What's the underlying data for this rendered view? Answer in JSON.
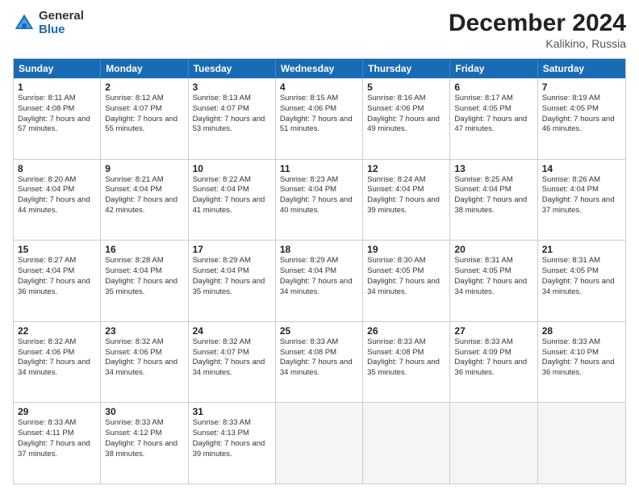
{
  "header": {
    "logo_general": "General",
    "logo_blue": "Blue",
    "month_title": "December 2024",
    "location": "Kalikino, Russia"
  },
  "days_of_week": [
    "Sunday",
    "Monday",
    "Tuesday",
    "Wednesday",
    "Thursday",
    "Friday",
    "Saturday"
  ],
  "weeks": [
    [
      {
        "day": "1",
        "sunrise": "8:11 AM",
        "sunset": "4:08 PM",
        "daylight": "7 hours and 57 minutes."
      },
      {
        "day": "2",
        "sunrise": "8:12 AM",
        "sunset": "4:07 PM",
        "daylight": "7 hours and 55 minutes."
      },
      {
        "day": "3",
        "sunrise": "8:13 AM",
        "sunset": "4:07 PM",
        "daylight": "7 hours and 53 minutes."
      },
      {
        "day": "4",
        "sunrise": "8:15 AM",
        "sunset": "4:06 PM",
        "daylight": "7 hours and 51 minutes."
      },
      {
        "day": "5",
        "sunrise": "8:16 AM",
        "sunset": "4:06 PM",
        "daylight": "7 hours and 49 minutes."
      },
      {
        "day": "6",
        "sunrise": "8:17 AM",
        "sunset": "4:05 PM",
        "daylight": "7 hours and 47 minutes."
      },
      {
        "day": "7",
        "sunrise": "8:19 AM",
        "sunset": "4:05 PM",
        "daylight": "7 hours and 46 minutes."
      }
    ],
    [
      {
        "day": "8",
        "sunrise": "8:20 AM",
        "sunset": "4:04 PM",
        "daylight": "7 hours and 44 minutes."
      },
      {
        "day": "9",
        "sunrise": "8:21 AM",
        "sunset": "4:04 PM",
        "daylight": "7 hours and 42 minutes."
      },
      {
        "day": "10",
        "sunrise": "8:22 AM",
        "sunset": "4:04 PM",
        "daylight": "7 hours and 41 minutes."
      },
      {
        "day": "11",
        "sunrise": "8:23 AM",
        "sunset": "4:04 PM",
        "daylight": "7 hours and 40 minutes."
      },
      {
        "day": "12",
        "sunrise": "8:24 AM",
        "sunset": "4:04 PM",
        "daylight": "7 hours and 39 minutes."
      },
      {
        "day": "13",
        "sunrise": "8:25 AM",
        "sunset": "4:04 PM",
        "daylight": "7 hours and 38 minutes."
      },
      {
        "day": "14",
        "sunrise": "8:26 AM",
        "sunset": "4:04 PM",
        "daylight": "7 hours and 37 minutes."
      }
    ],
    [
      {
        "day": "15",
        "sunrise": "8:27 AM",
        "sunset": "4:04 PM",
        "daylight": "7 hours and 36 minutes."
      },
      {
        "day": "16",
        "sunrise": "8:28 AM",
        "sunset": "4:04 PM",
        "daylight": "7 hours and 35 minutes."
      },
      {
        "day": "17",
        "sunrise": "8:29 AM",
        "sunset": "4:04 PM",
        "daylight": "7 hours and 35 minutes."
      },
      {
        "day": "18",
        "sunrise": "8:29 AM",
        "sunset": "4:04 PM",
        "daylight": "7 hours and 34 minutes."
      },
      {
        "day": "19",
        "sunrise": "8:30 AM",
        "sunset": "4:05 PM",
        "daylight": "7 hours and 34 minutes."
      },
      {
        "day": "20",
        "sunrise": "8:31 AM",
        "sunset": "4:05 PM",
        "daylight": "7 hours and 34 minutes."
      },
      {
        "day": "21",
        "sunrise": "8:31 AM",
        "sunset": "4:05 PM",
        "daylight": "7 hours and 34 minutes."
      }
    ],
    [
      {
        "day": "22",
        "sunrise": "8:32 AM",
        "sunset": "4:06 PM",
        "daylight": "7 hours and 34 minutes."
      },
      {
        "day": "23",
        "sunrise": "8:32 AM",
        "sunset": "4:06 PM",
        "daylight": "7 hours and 34 minutes."
      },
      {
        "day": "24",
        "sunrise": "8:32 AM",
        "sunset": "4:07 PM",
        "daylight": "7 hours and 34 minutes."
      },
      {
        "day": "25",
        "sunrise": "8:33 AM",
        "sunset": "4:08 PM",
        "daylight": "7 hours and 34 minutes."
      },
      {
        "day": "26",
        "sunrise": "8:33 AM",
        "sunset": "4:08 PM",
        "daylight": "7 hours and 35 minutes."
      },
      {
        "day": "27",
        "sunrise": "8:33 AM",
        "sunset": "4:09 PM",
        "daylight": "7 hours and 36 minutes."
      },
      {
        "day": "28",
        "sunrise": "8:33 AM",
        "sunset": "4:10 PM",
        "daylight": "7 hours and 36 minutes."
      }
    ],
    [
      {
        "day": "29",
        "sunrise": "8:33 AM",
        "sunset": "4:11 PM",
        "daylight": "7 hours and 37 minutes."
      },
      {
        "day": "30",
        "sunrise": "8:33 AM",
        "sunset": "4:12 PM",
        "daylight": "7 hours and 38 minutes."
      },
      {
        "day": "31",
        "sunrise": "8:33 AM",
        "sunset": "4:13 PM",
        "daylight": "7 hours and 39 minutes."
      },
      null,
      null,
      null,
      null
    ]
  ]
}
